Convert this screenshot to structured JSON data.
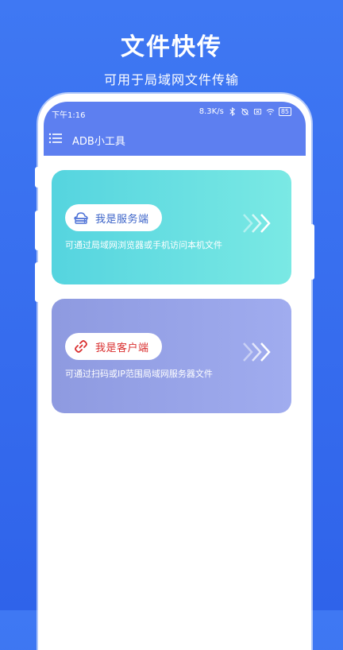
{
  "promo": {
    "title": "文件快传",
    "subtitle": "可用于局域网文件传输"
  },
  "status_bar": {
    "time": "下午1:16",
    "network_speed": "8.3K/s",
    "battery": "85"
  },
  "toolbar": {
    "title": "ADB小工具"
  },
  "cards": [
    {
      "label": "我是服务端",
      "description": "可通过局域网浏览器或手机访问本机文件",
      "icon": "server-cloud-icon"
    },
    {
      "label": "我是客户端",
      "description": "可通过扫码或IP范围局域网服务器文件",
      "icon": "link-icon"
    }
  ],
  "colors": {
    "background": "#3f78f3",
    "header": "#5d7ff0",
    "server_card": "#6ee0e2",
    "client_card": "#98a3e9",
    "server_label": "#3b63c8",
    "client_label": "#d92d2d"
  }
}
